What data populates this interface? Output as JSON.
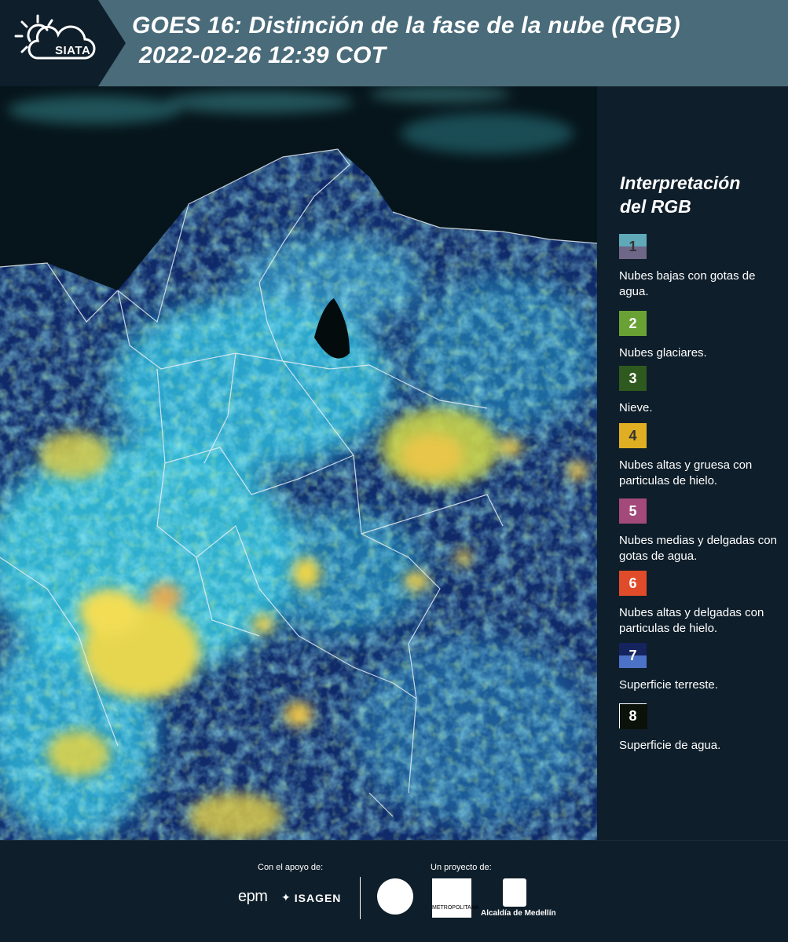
{
  "header": {
    "logo_text": "SIATA",
    "title_line1": "GOES 16: Distinción de la fase de la nube (RGB)",
    "title_line2": "2022-02-26 12:39 COT"
  },
  "legend": {
    "title_line1": "Interpretación",
    "title_line2": "del RGB",
    "items": [
      {
        "num": "1",
        "label": "Nubes bajas con gotas de agua.",
        "color_top": "#5fa9b9",
        "color_bottom": "#6e6788",
        "num_color": "#333333"
      },
      {
        "num": "2",
        "label": "Nubes glaciares.",
        "color_top": "#6aa135",
        "color_bottom": "#6aa135",
        "num_color": "#ffffff"
      },
      {
        "num": "3",
        "label": "Nieve.",
        "color_top": "#2f5a1f",
        "color_bottom": "#2f5a1f",
        "num_color": "#ffffff"
      },
      {
        "num": "4",
        "label": "Nubes altas y gruesa con particulas de hielo.",
        "color_top": "#e0ae23",
        "color_bottom": "#e0ae23",
        "num_color": "#333333"
      },
      {
        "num": "5",
        "label": "Nubes medias y delgadas con gotas de agua.",
        "color_top": "#a34a7a",
        "color_bottom": "#a34a7a",
        "num_color": "#ffffff"
      },
      {
        "num": "6",
        "label": "Nubes altas y delgadas con particulas de hielo.",
        "color_top": "#e04b2a",
        "color_bottom": "#e04b2a",
        "num_color": "#ffffff"
      },
      {
        "num": "7",
        "label": "Superficie terreste.",
        "color_top": "#15235e",
        "color_bottom": "#4b72c6",
        "num_color": "#ffffff"
      },
      {
        "num": "8",
        "label": "Superficie de agua.",
        "color_top": "#0a120a",
        "color_bottom": "#0a120a",
        "num_color": "#ffffff"
      }
    ]
  },
  "footer": {
    "support_label": "Con el apoyo de:",
    "project_label": "Un proyecto de:",
    "epm": "epm",
    "isagen": "ISAGEN",
    "area_text": "METROPOLITANA",
    "alcaldia": "Alcaldía de Medellín"
  },
  "colors": {
    "header_bg": "#4a6b7a",
    "header_dark": "#0e1e2a",
    "page_bg": "#0e1e2a"
  }
}
